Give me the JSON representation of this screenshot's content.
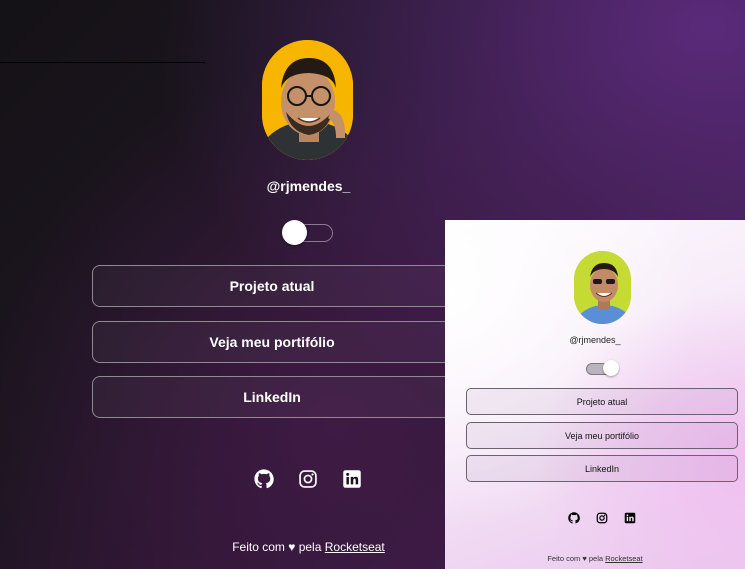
{
  "profile": {
    "handle": "@rjmendes_",
    "theme_toggle": "dark"
  },
  "links": [
    {
      "label": "Projeto atual"
    },
    {
      "label": "Veja meu portifólio"
    },
    {
      "label": "LinkedIn"
    }
  ],
  "social": [
    {
      "icon": "github-icon"
    },
    {
      "icon": "instagram-icon"
    },
    {
      "icon": "linkedin-icon"
    }
  ],
  "footer": {
    "prefix": "Feito com ♥ pela",
    "link": "Rocketseat"
  },
  "light_preview": {
    "handle": "@rjmendes_",
    "theme_toggle": "light",
    "links": [
      {
        "label": "Projeto atual"
      },
      {
        "label": "Veja meu portifólio"
      },
      {
        "label": "LinkedIn"
      }
    ],
    "footer": {
      "prefix": "Feito com ♥ pela",
      "link": "Rocketseat"
    }
  },
  "colors": {
    "dark_bg": "#1d1520",
    "dark_accent": "#4b2466",
    "light_bg": "#f5e6f7",
    "avatar_dark_bg": "#f7b500",
    "avatar_light_bg": "#c6da34"
  }
}
